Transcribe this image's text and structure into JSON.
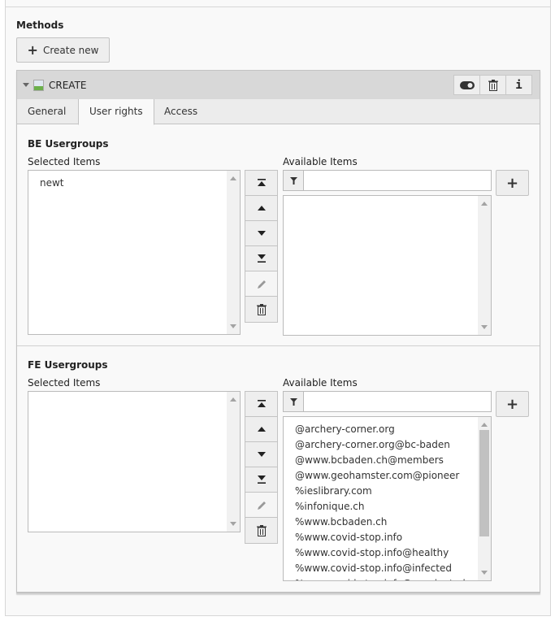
{
  "methods": {
    "title": "Methods",
    "create_new_label": "Create new"
  },
  "panel": {
    "title": "CREATE",
    "header_buttons": [
      "toggle-icon",
      "trash-icon",
      "info-icon"
    ],
    "info_label": "i",
    "tabs": [
      {
        "label": "General",
        "active": false
      },
      {
        "label": "User rights",
        "active": true
      },
      {
        "label": "Access",
        "active": false
      }
    ]
  },
  "be_usergroups": {
    "title": "BE Usergroups",
    "selected_label": "Selected Items",
    "selected_items": [
      "newt"
    ],
    "available_label": "Available Items",
    "filter_value": "",
    "available_items": []
  },
  "fe_usergroups": {
    "title": "FE Usergroups",
    "selected_label": "Selected Items",
    "selected_items": [],
    "available_label": "Available Items",
    "filter_value": "",
    "available_items": [
      "@archery-corner.org",
      "@archery-corner.org@bc-baden",
      "@www.bcbaden.ch@members",
      "@www.geohamster.com@pioneer",
      "%ieslibrary.com",
      "%infonique.ch",
      "%www.bcbaden.ch",
      "%www.covid-stop.info",
      "%www.covid-stop.info@healthy",
      "%www.covid-stop.info@infected",
      "%www.covid-stop.info@vaccinated"
    ]
  },
  "add_label": "+"
}
